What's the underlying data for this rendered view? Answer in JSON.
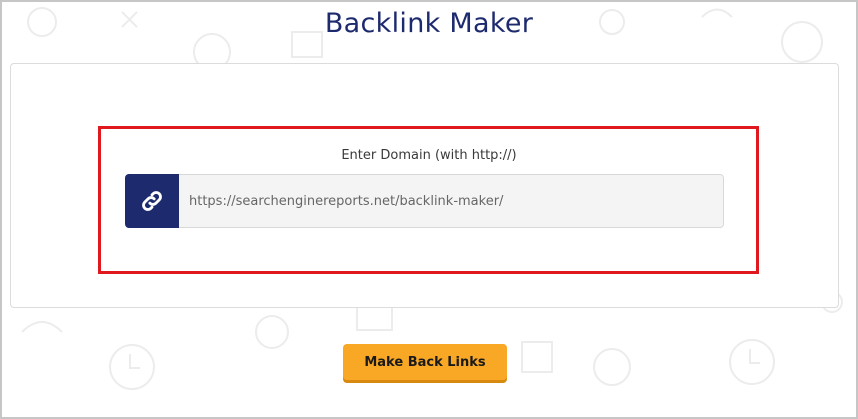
{
  "page": {
    "title": "Backlink Maker"
  },
  "form": {
    "label": "Enter Domain (with http://)",
    "input_value": "https://searchenginereports.net/backlink-maker/",
    "icon": "link-icon",
    "submit_label": "Make Back Links"
  },
  "colors": {
    "title": "#1e2a6e",
    "icon_bg": "#1d2b6e",
    "highlight": "#e0191f",
    "button": "#f9a825"
  }
}
